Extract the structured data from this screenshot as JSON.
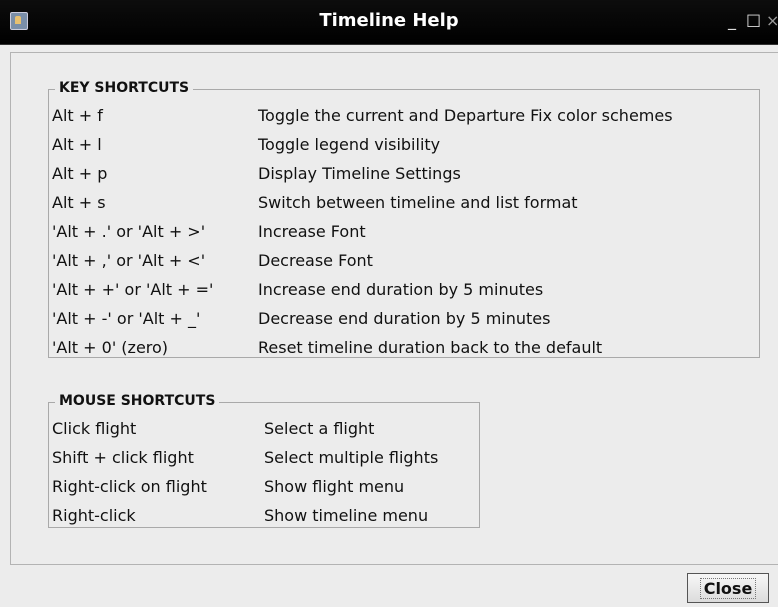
{
  "window": {
    "title": "Timeline Help",
    "controls": {
      "minimize": "_",
      "maximize": "□",
      "close": "×"
    }
  },
  "key_shortcuts": {
    "title": "KEY SHORTCUTS",
    "items": [
      {
        "key": "Alt + f",
        "desc": "Toggle the current and Departure Fix color schemes"
      },
      {
        "key": "Alt + l",
        "desc": "Toggle legend visibility"
      },
      {
        "key": "Alt + p",
        "desc": "Display Timeline Settings"
      },
      {
        "key": "Alt + s",
        "desc": "Switch between timeline and list format"
      },
      {
        "key": "'Alt + .' or 'Alt + >'",
        "desc": "Increase Font"
      },
      {
        "key": "'Alt + ,' or 'Alt + <'",
        "desc": "Decrease Font"
      },
      {
        "key": "'Alt + +' or 'Alt + ='",
        "desc": "Increase end duration by 5 minutes"
      },
      {
        "key": "'Alt + -' or 'Alt + _'",
        "desc": "Decrease end duration by 5 minutes"
      },
      {
        "key": "'Alt + 0' (zero)",
        "desc": "Reset timeline duration back to the default"
      }
    ]
  },
  "mouse_shortcuts": {
    "title": "MOUSE SHORTCUTS",
    "items": [
      {
        "key": "Click flight",
        "desc": "Select a flight"
      },
      {
        "key": "Shift + click flight",
        "desc": "Select multiple flights"
      },
      {
        "key": "Right-click on flight",
        "desc": "Show flight menu"
      },
      {
        "key": "Right-click",
        "desc": "Show timeline menu"
      }
    ]
  },
  "buttons": {
    "close": "Close"
  }
}
